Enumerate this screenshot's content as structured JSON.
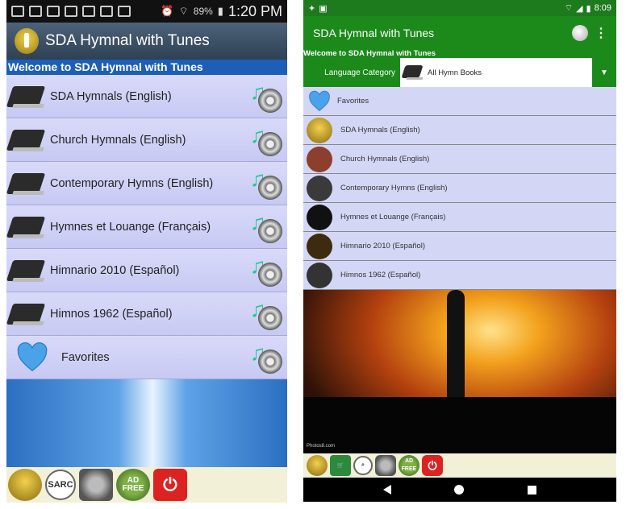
{
  "left": {
    "status": {
      "battery": "89%",
      "time": "1:20 PM"
    },
    "title": "SDA Hymnal with Tunes",
    "welcome": "Welcome to SDA Hymnal with Tunes",
    "items": [
      {
        "label": "SDA Hymnals (English)"
      },
      {
        "label": "Church Hymnals (English)"
      },
      {
        "label": "Contemporary Hymns (English)"
      },
      {
        "label": "Hymnes et Louange (Français)"
      },
      {
        "label": "Himnario 2010 (Español)"
      },
      {
        "label": "Himnos 1962 (Español)"
      }
    ],
    "favorites": "Favorites",
    "toolbar": {
      "search": "SARC",
      "ad": "AD FREE",
      "power": "⏻"
    }
  },
  "right": {
    "status": {
      "time": "8:09"
    },
    "title": "SDA Hymnal with Tunes",
    "welcome": "Welcome to SDA Hymnal with Tunes",
    "category_label": "Language Category",
    "category_value": "All Hymn Books",
    "favorites": "Favorites",
    "items": [
      {
        "label": "SDA Hymnals (English)"
      },
      {
        "label": "Church Hymnals (English)"
      },
      {
        "label": "Contemporary Hymns (English)"
      },
      {
        "label": "Hymnes et Louange (Français)"
      },
      {
        "label": "Himnario 2010 (Español)"
      },
      {
        "label": "Himnos 1962 (Español)"
      }
    ],
    "image_credit": "Photos8.com",
    "toolbar": {
      "ad": "AD FREE",
      "power": "⏻"
    }
  },
  "colors": {
    "left_header": "#3a4f64",
    "left_welcome": "#1d5fb6",
    "right_header": "#1b8a1b",
    "list_bg": "#d4d6f6"
  }
}
